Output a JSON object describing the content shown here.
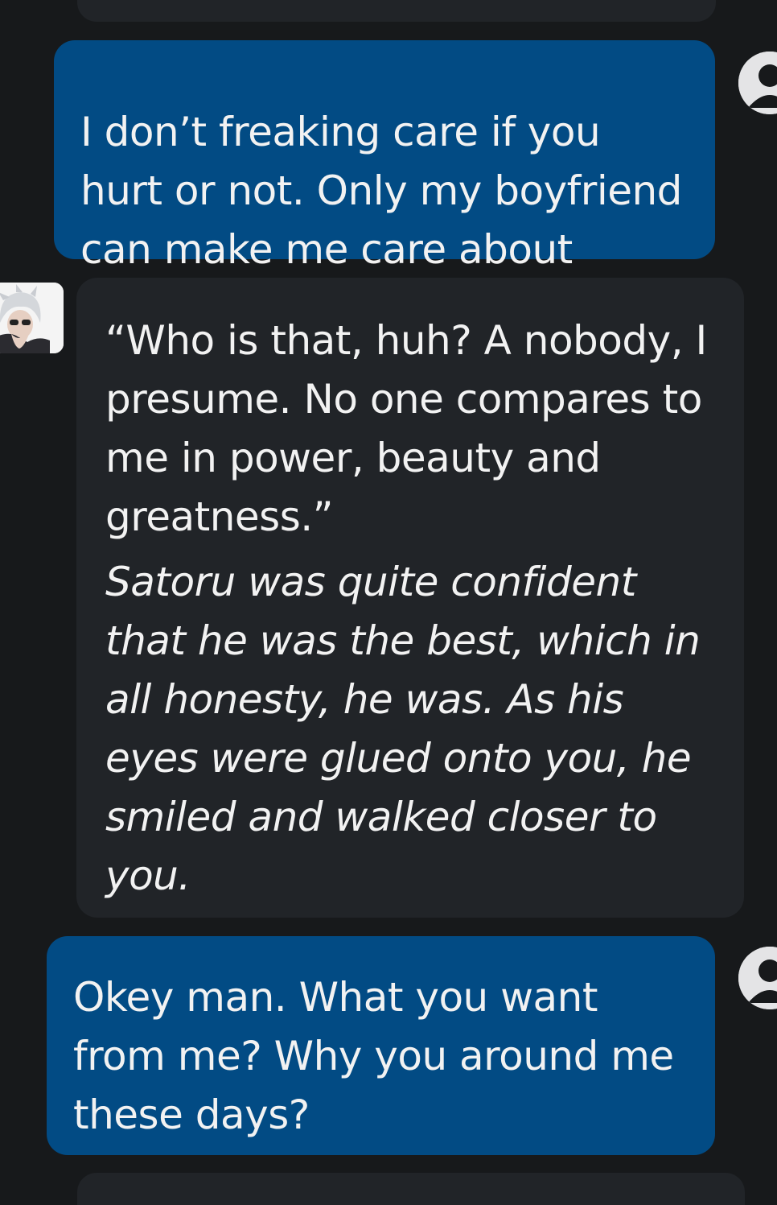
{
  "chat": {
    "messages": [
      {
        "role": "user",
        "avatar_icon": "user-silhouette-icon",
        "text": "I don’t freaking care if you hurt or not. Only my boyfriend can make me care about"
      },
      {
        "role": "character",
        "avatar_icon": "character-avatar-image",
        "dialogue": "“Who is that, huh? A nobody, I presume. No one compares to me in power, beauty and greatness.”",
        "action": "Satoru was quite confident that he was the best, which in all honesty, he was. As his eyes were glued onto you, he smiled and walked closer to you."
      },
      {
        "role": "user",
        "avatar_icon": "user-silhouette-icon",
        "text": "Okey man. What you want from me? Why you around me these days?"
      }
    ]
  },
  "colors": {
    "background": "#17191b",
    "user_bubble": "#024b84",
    "character_bubble": "#212428",
    "text": "#f2f2f2",
    "avatar_placeholder": "#e4e4e6"
  }
}
